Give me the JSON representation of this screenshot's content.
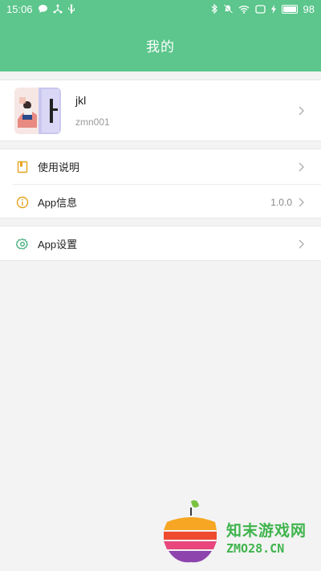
{
  "status_bar": {
    "time": "15:06",
    "battery_level": "98"
  },
  "header": {
    "title": "我的"
  },
  "profile": {
    "username": "jkl",
    "user_id": "zmn001"
  },
  "menu": [
    {
      "label": "使用说明",
      "value": "",
      "icon": "book-icon"
    },
    {
      "label": "App信息",
      "value": "1.0.0",
      "icon": "info-icon"
    },
    {
      "label": "App设置",
      "value": "",
      "icon": "gear-icon"
    }
  ],
  "watermark": {
    "text": "知末游戏网",
    "url": "ZMO28.CN"
  },
  "colors": {
    "primary": "#5cc68c",
    "book_icon": "#e6a21e",
    "info_icon": "#e6a21e",
    "gear_icon": "#3aa876"
  }
}
